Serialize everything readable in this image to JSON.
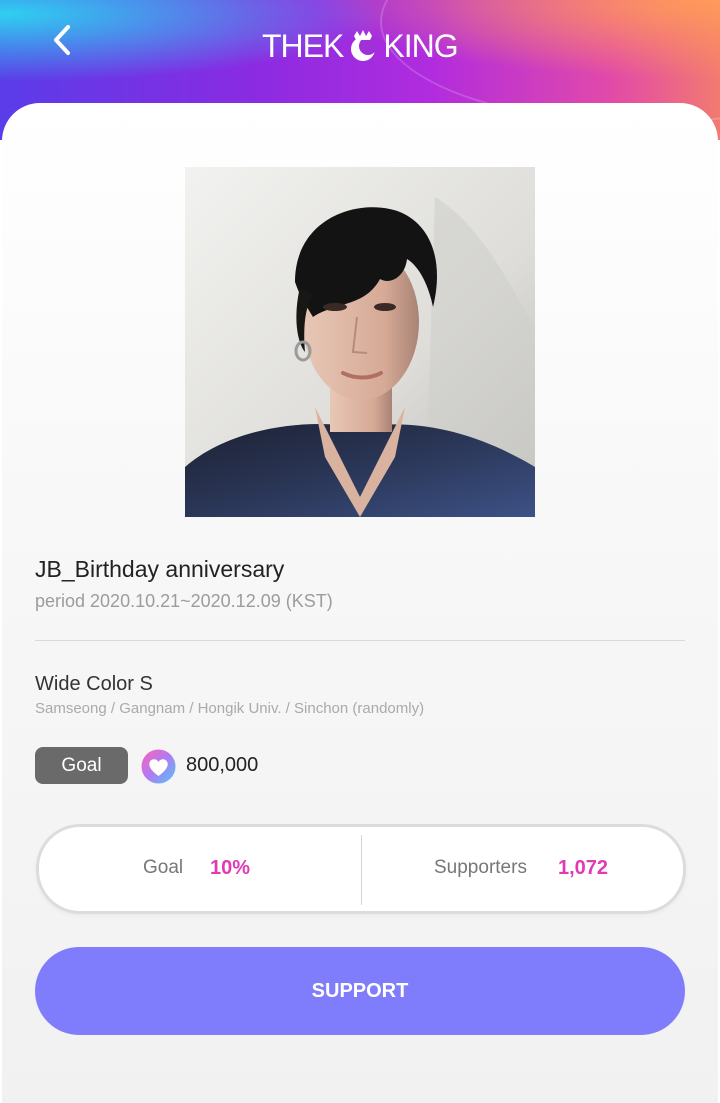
{
  "header": {
    "back_icon": "chevron-left-icon",
    "logo_left": "THEK",
    "logo_right": "KING",
    "logo_icon": "crown-moon-icon"
  },
  "campaign": {
    "title": "JB_Birthday anniversary",
    "period": "period 2020.10.21~2020.12.09 (KST)",
    "product": "Wide Color S",
    "locations": "Samseong / Gangnam / Hongik Univ. / Sinchon (randomly)",
    "goal_label": "Goal",
    "goal_amount": "800,000",
    "goal_icon": "heart-coin-icon"
  },
  "stats": {
    "goal_label": "Goal",
    "goal_value": "10%",
    "supporters_label": "Supporters",
    "supporters_value": "1,072"
  },
  "actions": {
    "support_label": "SUPPORT"
  },
  "colors": {
    "accent_pink": "#e03ab4",
    "button_purple": "#7f7dfb",
    "badge_gray": "#6a6a6a"
  }
}
